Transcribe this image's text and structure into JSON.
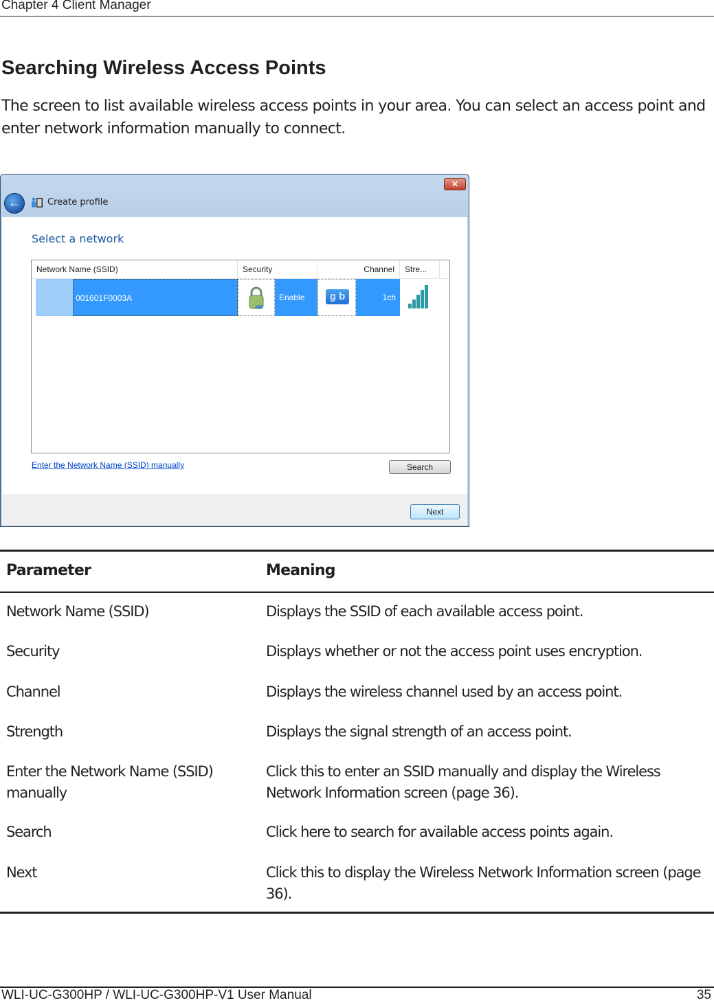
{
  "page": {
    "chapter": "Chapter 4  Client Manager",
    "title": "Searching Wireless Access Points",
    "intro": "The screen to list available wireless access points in your area.  You can select an access point and enter network information manually to connect."
  },
  "window": {
    "nav_title": "Create profile",
    "heading": "Select a network",
    "close_icon": "close-icon",
    "back_icon": "back-arrow-icon",
    "list": {
      "columns": [
        "Network Name (SSID)",
        "Security",
        "Channel",
        "Stre..."
      ],
      "rows": [
        {
          "ssid": "001601F0003A",
          "security_icon": "lock-icon",
          "security": "Enable",
          "mode_icon": "gb-mode-icon",
          "mode_label": "g b",
          "channel": "1ch",
          "strength_icon": "signal-bars-icon",
          "selected": true
        }
      ]
    },
    "manual_link": "Enter the Network Name (SSID) manually",
    "search_button": "Search",
    "next_button": "Next",
    "selection_color": "#3399ff"
  },
  "table": {
    "headers": [
      "Parameter",
      "Meaning"
    ],
    "rows": [
      {
        "parameter": "Network Name (SSID)",
        "meaning": "Displays the SSID of each available access point."
      },
      {
        "parameter": "Security",
        "meaning": "Displays whether or not the access point uses encryption."
      },
      {
        "parameter": "Channel",
        "meaning": "Displays the wireless channel used by an access point."
      },
      {
        "parameter": "Strength",
        "meaning": "Displays the signal strength of an access point."
      },
      {
        "parameter": "Enter the Network Name (SSID) manually",
        "meaning": "Click this to enter an SSID manually and display the Wireless Network Information screen (page 36)."
      },
      {
        "parameter": "Search",
        "meaning": "Click here to search for available access points again."
      },
      {
        "parameter": "Next",
        "meaning": "Click this to display the Wireless Network Information screen (page 36)."
      }
    ]
  },
  "footer": {
    "manual": "WLI-UC-G300HP / WLI-UC-G300HP-V1 User Manual",
    "page_number": "35"
  }
}
